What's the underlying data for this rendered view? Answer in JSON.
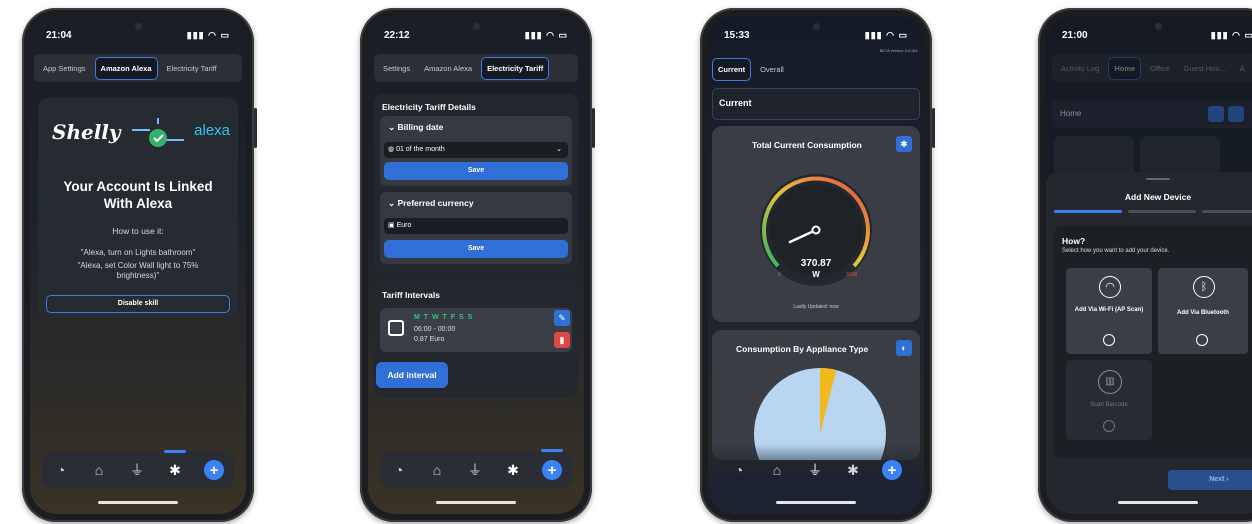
{
  "phone1": {
    "time": "21:04",
    "tabs": [
      "App Settings",
      "Amazon Alexa",
      "Electricity Tariff"
    ],
    "logo_shelly": "Shelly",
    "logo_alexa": "alexa",
    "heading": "Your Account Is Linked With Alexa",
    "how_to": "How to use it:",
    "example1": "\"Alexa, turn on Lights bathroom\"",
    "example2": "\"Alexa, set Color Wall light to 75% brightness)\"",
    "disable_label": "Disable skill"
  },
  "phone2": {
    "time": "22:12",
    "tabs": [
      "Settings",
      "Amazon Alexa",
      "Electricity Tariff"
    ],
    "section_title": "Electricity Tariff Details",
    "billing_title": "Billing date",
    "billing_value": "01 of the month",
    "save_label": "Save",
    "currency_title": "Preferred currency",
    "currency_value": "Euro",
    "intervals_title": "Tariff Intervals",
    "interval_days": "M T W T F S S",
    "interval_time": "06:00 - 00:00",
    "interval_price": "0.87 Euro",
    "add_interval": "Add interval"
  },
  "phone3": {
    "time": "15:33",
    "beta_text": "BETA version 3.0.0b1",
    "tabs": [
      "Current",
      "Overall"
    ],
    "header_title": "Current",
    "card1_title": "Total Current Consumption",
    "gauge_value": "370.87",
    "gauge_unit": "W",
    "gauge_min": "0",
    "gauge_max": "3098",
    "updated": "Lastly Updated: now",
    "card2_title": "Consumption By Appliance Type",
    "pie_share": 0.04,
    "pie_colors": {
      "main": "#b8d6f2",
      "slice": "#f2b91c"
    },
    "gauge_fraction": 0.12
  },
  "phone4": {
    "time": "21:00",
    "tabs": [
      "Activity Log",
      "Home",
      "Office",
      "Guest Hou...",
      "A"
    ],
    "room_label": "Home",
    "sheet_title": "Add New Device",
    "how_title": "How?",
    "how_sub": "Select how you want to add your device.",
    "opt_wifi": "Add Via Wi-Fi (AP Scan)",
    "opt_bt": "Add Via Bluetooth",
    "opt_barcode": "Scan Barcode",
    "next_label": "Next"
  }
}
